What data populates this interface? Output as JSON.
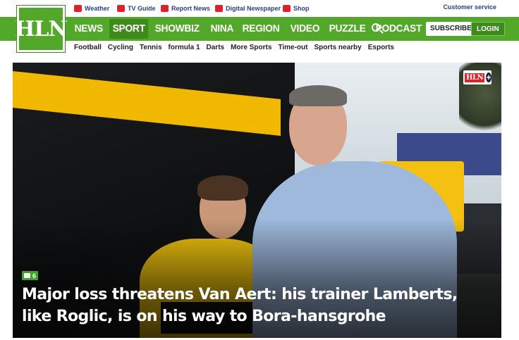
{
  "topbar": {
    "links": [
      {
        "label": "Weather",
        "icon": "weather-icon"
      },
      {
        "label": "TV Guide",
        "icon": "tv-icon"
      },
      {
        "label": "Report News",
        "icon": "megaphone-icon"
      },
      {
        "label": "Digital Newspaper",
        "icon": "newspaper-icon"
      },
      {
        "label": "Shop",
        "icon": "cart-icon"
      }
    ],
    "customer_service": "Customer service"
  },
  "logo": {
    "text": "HLN"
  },
  "nav": {
    "items": [
      "NEWS",
      "SPORT",
      "SHOWBIZ",
      "NINA",
      "REGION",
      "VIDEO",
      "PUZZLE",
      "PODCAST"
    ],
    "active": "SPORT",
    "subscribe": "SUBSCRIBE",
    "login": "LOGIN"
  },
  "subnav": {
    "items": [
      "Football",
      "Cycling",
      "Tennis",
      "formula 1",
      "Darts",
      "More Sports",
      "Time-out",
      "Sports nearby",
      "Esports"
    ]
  },
  "article": {
    "badge": "HLN",
    "comments_count": "6",
    "headline": "Major loss threatens Van Aert: his trainer Lamberts, like Roglic, is on his way to Bora-hansgrohe"
  },
  "colors": {
    "brand_green": "#52a829",
    "dark_green": "#3e8a1c",
    "accent_red": "#e2202a",
    "link_blue": "#2a3f8f"
  }
}
